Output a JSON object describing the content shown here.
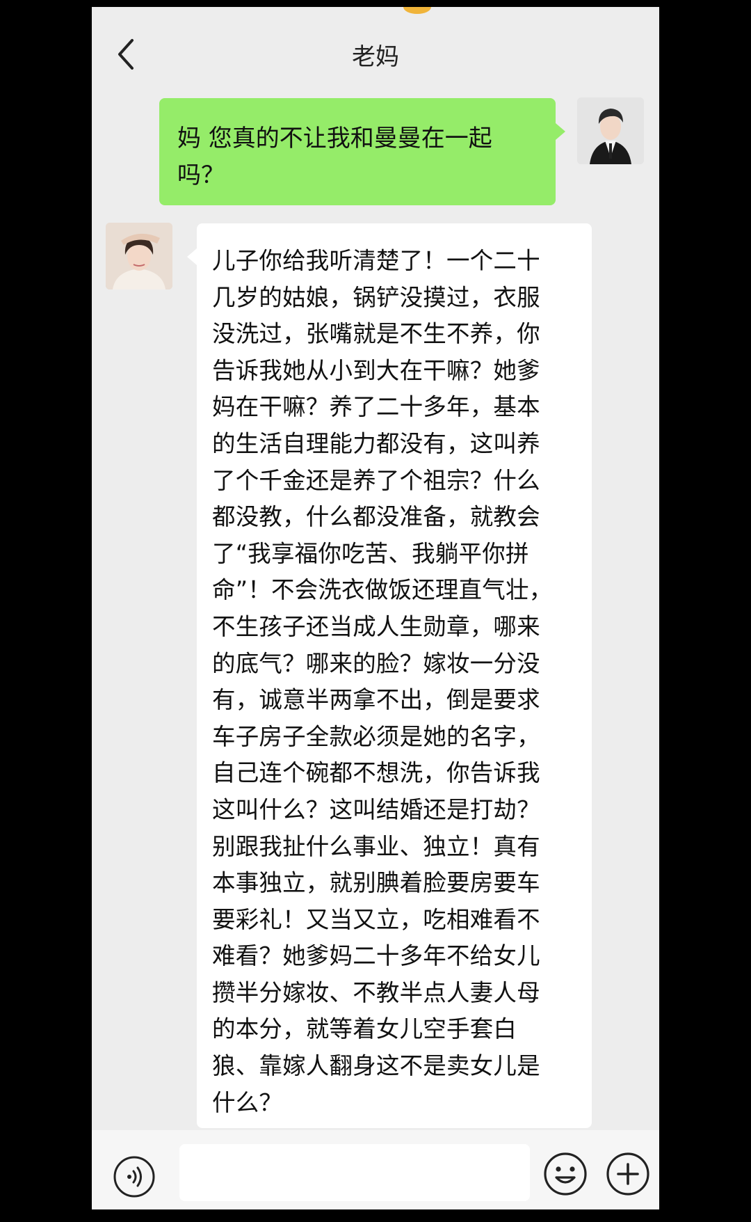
{
  "header": {
    "title": "老妈",
    "back_icon": "chevron-left-icon"
  },
  "messages": [
    {
      "sender": "me",
      "avatar_icon": "avatar-son",
      "lines": [
        "妈 您真的不让我和曼曼在一起",
        "吗？"
      ]
    },
    {
      "sender": "mom",
      "avatar_icon": "avatar-mom",
      "lines": [
        "儿子你给我听清楚了！一个二十",
        "几岁的姑娘，锅铲没摸过，衣服",
        "没洗过，张嘴就是不生不养，你",
        "告诉我她从小到大在干嘛？她爹",
        "妈在干嘛？养了二十多年，基本",
        "的生活自理能力都没有，这叫养",
        "了个千金还是养了个祖宗？什么",
        "都没教，什么都没准备，就教会",
        "了“我享福你吃苦、我躺平你拼",
        "命”！不会洗衣做饭还理直气壮，",
        "不生孩子还当成人生勋章，哪来",
        "的底气？哪来的脸？嫁妆一分没",
        "有，诚意半两拿不出，倒是要求",
        "车子房子全款必须是她的名字，",
        "自己连个碗都不想洗，你告诉我",
        "这叫什么？这叫结婚还是打劫？",
        "别跟我扯什么事业、独立！真有",
        "本事独立，就别腆着脸要房要车",
        "要彩礼！又当又立，吃相难看不",
        "难看？她爹妈二十多年不给女儿",
        "攒半分嫁妆、不教半点人妻人母",
        "的本分，就等着女儿空手套白",
        "狼、靠嫁人翻身这不是卖女儿是",
        "什么？"
      ]
    }
  ],
  "input_bar": {
    "voice_icon": "voice-icon",
    "input_value": "",
    "emoji_icon": "emoji-icon",
    "plus_icon": "plus-icon"
  },
  "colors": {
    "background": "#ededed",
    "outgoing_bubble": "#95ec69",
    "incoming_bubble": "#ffffff",
    "bottom_bar": "#f6f6f6"
  }
}
